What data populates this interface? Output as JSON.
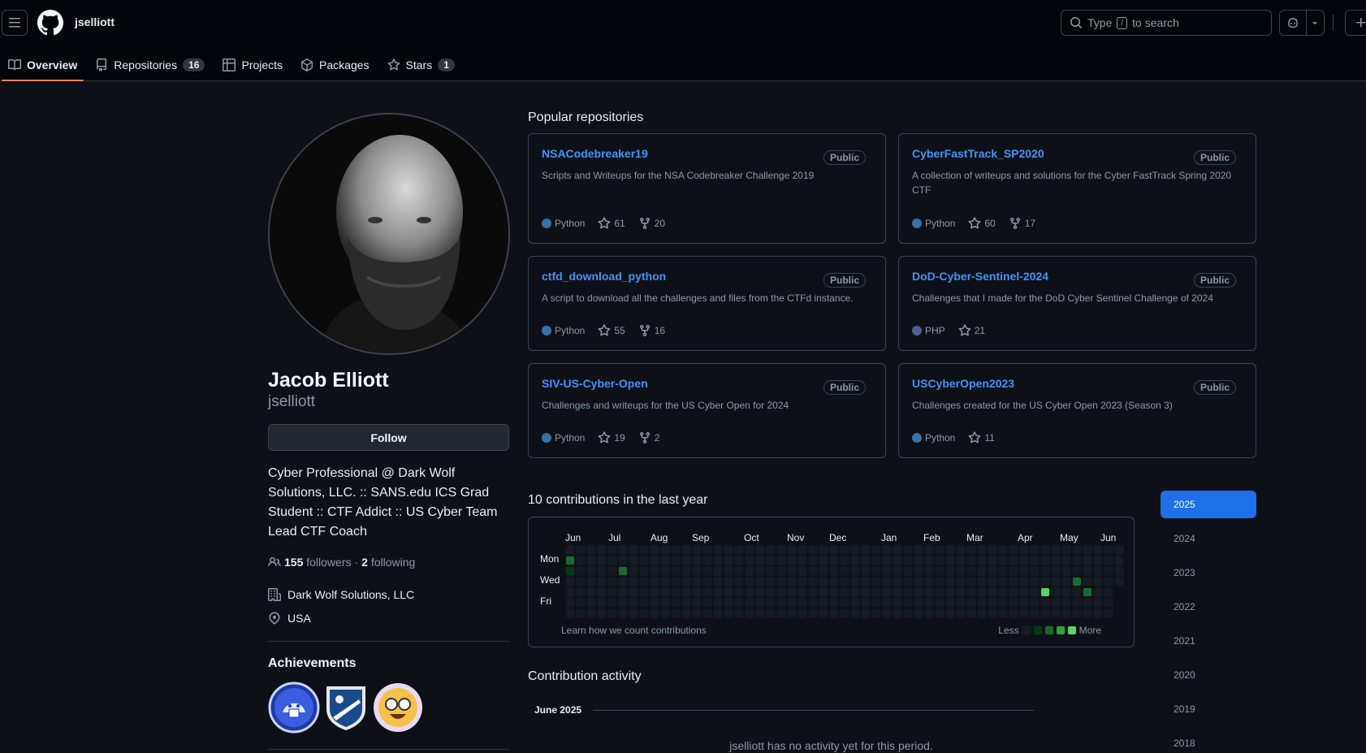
{
  "header": {
    "username": "jselliott",
    "search_placeholder_prefix": "Type",
    "search_key": "/",
    "search_placeholder_suffix": "to search"
  },
  "tabs": [
    {
      "label": "Overview",
      "count": null
    },
    {
      "label": "Repositories",
      "count": "16"
    },
    {
      "label": "Projects",
      "count": null
    },
    {
      "label": "Packages",
      "count": null
    },
    {
      "label": "Stars",
      "count": "1"
    }
  ],
  "profile": {
    "name": "Jacob Elliott",
    "login": "jselliott",
    "follow_label": "Follow",
    "bio": "Cyber Professional @ Dark Wolf Solutions, LLC. :: SANS.edu ICS Grad Student :: CTF Addict :: US Cyber Team Lead CTF Coach",
    "followers_count": "155",
    "followers_label": "followers",
    "separator": "·",
    "following_count": "2",
    "following_label": "following",
    "organization": "Dark Wolf Solutions, LLC",
    "location": "USA",
    "achievements_title": "Achievements"
  },
  "popular": {
    "title": "Popular repositories",
    "repos": [
      {
        "name": "NSACodebreaker19",
        "visibility": "Public",
        "desc": "Scripts and Writeups for the NSA Codebreaker Challenge 2019",
        "lang": "Python",
        "lang_color": "#3572A5",
        "stars": "61",
        "forks": "20"
      },
      {
        "name": "CyberFastTrack_SP2020",
        "visibility": "Public",
        "desc": "A collection of writeups and solutions for the Cyber FastTrack Spring 2020 CTF",
        "lang": "Python",
        "lang_color": "#3572A5",
        "stars": "60",
        "forks": "17"
      },
      {
        "name": "ctfd_download_python",
        "visibility": "Public",
        "desc": "A script to download all the challenges and files from the CTFd instance.",
        "lang": "Python",
        "lang_color": "#3572A5",
        "stars": "55",
        "forks": "16"
      },
      {
        "name": "DoD-Cyber-Sentinel-2024",
        "visibility": "Public",
        "desc": "Challenges that I made for the DoD Cyber Sentinel Challenge of 2024",
        "lang": "PHP",
        "lang_color": "#4F5D95",
        "stars": "21",
        "forks": null
      },
      {
        "name": "SIV-US-Cyber-Open",
        "visibility": "Public",
        "desc": "Challenges and writeups for the US Cyber Open for 2024",
        "lang": "Python",
        "lang_color": "#3572A5",
        "stars": "19",
        "forks": "2"
      },
      {
        "name": "USCyberOpen2023",
        "visibility": "Public",
        "desc": "Challenges created for the US Cyber Open 2023 (Season 3)",
        "lang": "Python",
        "lang_color": "#3572A5",
        "stars": "11",
        "forks": null
      }
    ]
  },
  "contributions": {
    "title": "10 contributions in the last year",
    "months": [
      "Jun",
      "Jul",
      "Aug",
      "Sep",
      "Oct",
      "Nov",
      "Dec",
      "Jan",
      "Feb",
      "Mar",
      "Apr",
      "May",
      "Jun"
    ],
    "days": [
      "Mon",
      "Wed",
      "Fri"
    ],
    "learn_link": "Learn how we count contributions",
    "legend_less": "Less",
    "legend_more": "More",
    "level_colors": [
      "#151b23",
      "#033a16",
      "#196c2e",
      "#2ea043",
      "#56d364"
    ],
    "active_cells": [
      {
        "week": 0,
        "day": 1,
        "level": 2
      },
      {
        "week": 0,
        "day": 2,
        "level": 1
      },
      {
        "week": 5,
        "day": 2,
        "level": 2
      },
      {
        "week": 45,
        "day": 4,
        "level": 4
      },
      {
        "week": 48,
        "day": 3,
        "level": 2
      },
      {
        "week": 49,
        "day": 4,
        "level": 2
      }
    ]
  },
  "years": [
    "2025",
    "2024",
    "2023",
    "2022",
    "2021",
    "2020",
    "2019",
    "2018"
  ],
  "activity": {
    "title": "Contribution activity",
    "month": "June 2025",
    "empty": "jselliott has no activity yet for this period."
  }
}
